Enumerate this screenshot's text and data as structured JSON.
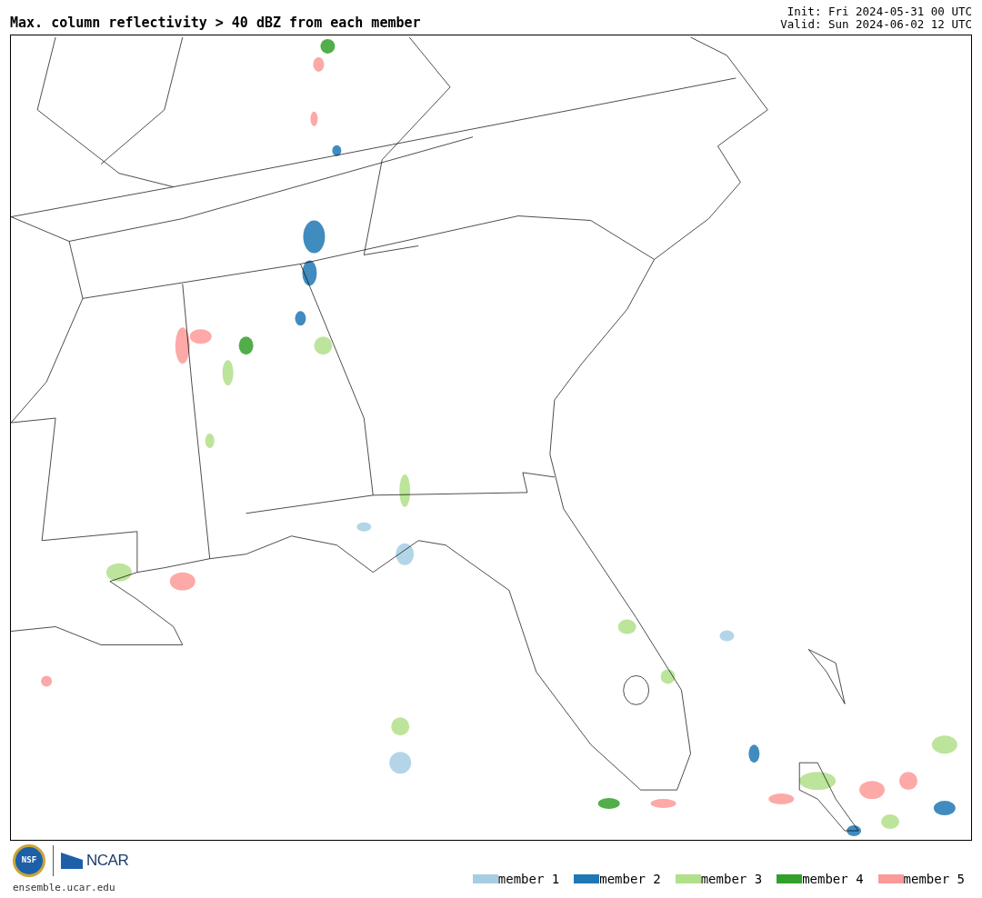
{
  "title": "Max. column reflectivity > 40 dBZ from each member",
  "init": "Init: Fri 2024-05-31 00 UTC",
  "valid": "Valid: Sun 2024-06-02 12 UTC",
  "logos": {
    "nsf": "NSF",
    "ncar": "NCAR"
  },
  "url": "ensemble.ucar.edu",
  "legend": [
    {
      "label": "member 1",
      "color": "#a6cee3"
    },
    {
      "label": "member 2",
      "color": "#1f78b4"
    },
    {
      "label": "member 3",
      "color": "#b2df8a"
    },
    {
      "label": "member 4",
      "color": "#33a02c"
    },
    {
      "label": "member 5",
      "color": "#fb9a99"
    }
  ]
}
